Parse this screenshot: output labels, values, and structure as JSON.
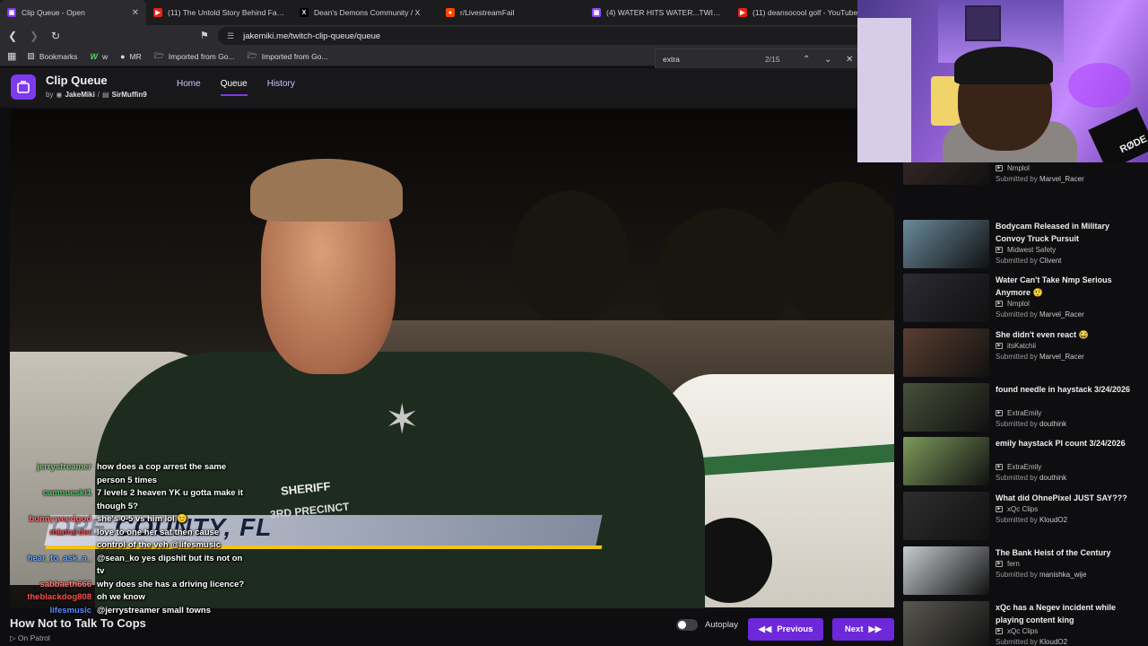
{
  "browser": {
    "tabs": [
      {
        "title": "Clip Queue - Open",
        "icon": "twitch-icon",
        "color": "#7c3aed",
        "active": true
      },
      {
        "title": "(11) The Untold Story Behind FaZe C",
        "icon": "youtube-icon",
        "color": "#e62117"
      },
      {
        "title": "Dean's Demons Community / X",
        "icon": "x-icon",
        "color": "#000000"
      },
      {
        "title": "r/LivestreamFail",
        "icon": "reddit-icon",
        "color": "#ff4500"
      },
      {
        "title": "(4) WATER HITS WATER...TWICE - Tw",
        "icon": "twitch-icon",
        "color": "#9146ff"
      },
      {
        "title": "(11) deansocool golf - YouTube",
        "icon": "youtube-icon",
        "color": "#e62117"
      }
    ],
    "url": "jakemiki.me/twitch-clip-queue/queue",
    "bookmarks": [
      {
        "label": "Bookmarks",
        "icon": "bookmark-folder-icon"
      },
      {
        "label": "w",
        "icon": "w-icon"
      },
      {
        "label": "MR",
        "icon": "mr-icon"
      },
      {
        "label": "Imported from Go...",
        "icon": "folder-icon"
      },
      {
        "label": "Imported from Go...",
        "icon": "folder-icon"
      }
    ],
    "find": {
      "query": "extra",
      "count": "2/15"
    }
  },
  "app": {
    "title": "Clip Queue",
    "by": "by",
    "author1": "JakeMiki",
    "author2": "SirMuffin9",
    "nav": [
      "Home",
      "Queue",
      "History"
    ],
    "active_nav": "Queue"
  },
  "video": {
    "overlay_text": "COUNTY, FL",
    "uniform_text": "SHERIFF",
    "precinct_text": "3RD PRECINCT",
    "title": "How Not to Talk To Cops",
    "subtitle": "On Patrol"
  },
  "chat": [
    {
      "user": "jerrystreamer",
      "color": "#7cc47a",
      "msg": "how does a cop arrest the same person 5 times"
    },
    {
      "user": "camnueski1",
      "color": "#54c06b",
      "msg": "7 levels 2 heaven YK u gotta make it though 5?"
    },
    {
      "user": "bunnyweedgod",
      "color": "#ff6b6b",
      "msg": "she's 0-5 vs him lol 😊"
    },
    {
      "user": "mkmurder",
      "color": "#e04b4b",
      "msg": "love to one her sat then cause control of the veh @lifesmusic"
    },
    {
      "user": "hear_to_ask_a_",
      "color": "#6aa9ff",
      "msg": "@sean_ko yes dipshit but its not on tv"
    },
    {
      "user": "sabbaeth666",
      "color": "#ff7b7b",
      "msg": "why does she has a driving licence?"
    },
    {
      "user": "theblackdog808",
      "color": "#ff4f4f",
      "msg": "oh we know"
    },
    {
      "user": "lifesmusic",
      "color": "#5a8cff",
      "msg": "@jerrystreamer small towns"
    }
  ],
  "controls": {
    "autoplay": "Autoplay",
    "previous": "Previous",
    "next": "Next",
    "autoplay_on": false
  },
  "queue": [
    {
      "title": "",
      "channel": "Nmplol",
      "submitter": "Marvel_Racer",
      "thumb": "#3a2a28"
    },
    {
      "title": "Bodycam Released in Military Convoy Truck Pursuit",
      "channel": "Midwest Safety",
      "submitter": "Clivent",
      "thumb": "#6a8a9c"
    },
    {
      "title": "Water Can't Take Nmp Serious Anymore 🤨",
      "channel": "Nmplol",
      "submitter": "Marvel_Racer",
      "thumb": "#2c2a33"
    },
    {
      "title": "She didn't even react 😂",
      "channel": "itsKatchii",
      "submitter": "Marvel_Racer",
      "thumb": "#5a3d30"
    },
    {
      "title": "found needle in haystack 3/24/2026",
      "channel": "ExtraEmily",
      "submitter": "douthink",
      "thumb": "#48503a"
    },
    {
      "title": "emily haystack PI count 3/24/2026",
      "channel": "ExtraEmily",
      "submitter": "douthink",
      "thumb": "#7d9a5a"
    },
    {
      "title": "What did OhnePixel JUST SAY???",
      "channel": "xQc Clips",
      "submitter": "KloudO2",
      "thumb": "#2e2e2e"
    },
    {
      "title": "The Bank Heist of the Century",
      "channel": "fern",
      "submitter": "manishka_wije",
      "thumb": "#c8ccd0"
    },
    {
      "title": "xQc has a Negev incident while playing content king",
      "channel": "xQc Clips",
      "submitter": "KloudO2",
      "thumb": "#5a5850"
    }
  ],
  "queue_label": {
    "submitted_by": "Submitted by"
  },
  "webcam": {
    "brand": "RØDE"
  }
}
